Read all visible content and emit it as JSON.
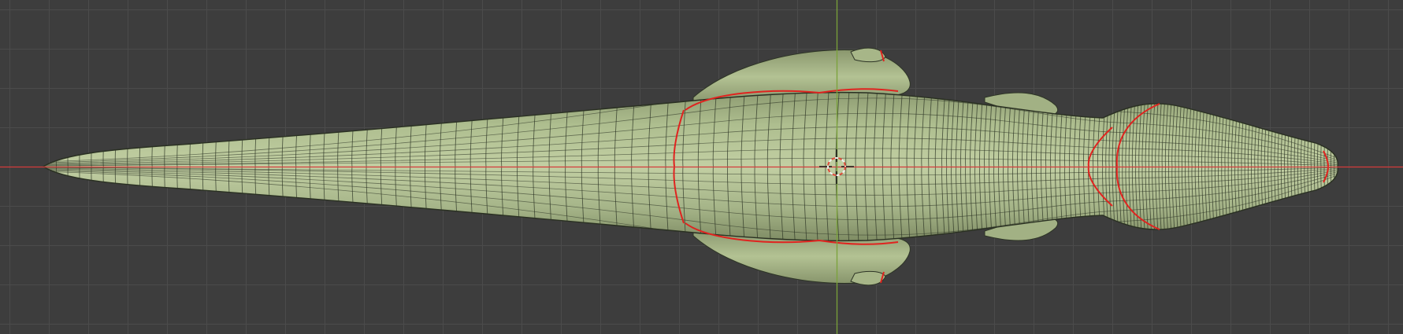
{
  "viewport": {
    "name": "3d-viewport",
    "background_color": "#3d3d3d",
    "grid_color": "#4b4b4b",
    "axis_x_color": "#d43c3c",
    "axis_y_color": "#7aa23a"
  },
  "mesh": {
    "name": "dinosaur-mesh-top-view",
    "surface_color": "#a9b98c",
    "wire_color": "#2e3526",
    "seam_color": "#e0231f"
  },
  "cursor": {
    "name": "3d-cursor",
    "ring_color_1": "#e04a3a",
    "ring_color_2": "#f2f2f2"
  }
}
